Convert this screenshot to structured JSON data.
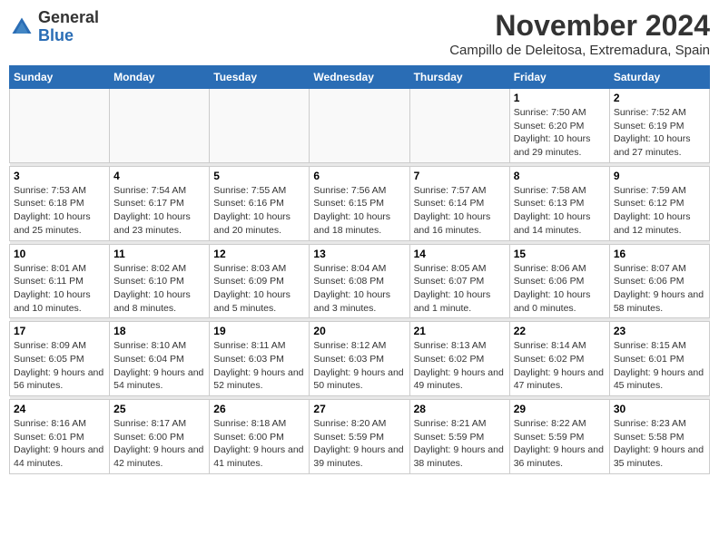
{
  "header": {
    "logo_general": "General",
    "logo_blue": "Blue",
    "month_title": "November 2024",
    "subtitle": "Campillo de Deleitosa, Extremadura, Spain"
  },
  "days_of_week": [
    "Sunday",
    "Monday",
    "Tuesday",
    "Wednesday",
    "Thursday",
    "Friday",
    "Saturday"
  ],
  "weeks": [
    [
      {
        "day": "",
        "info": ""
      },
      {
        "day": "",
        "info": ""
      },
      {
        "day": "",
        "info": ""
      },
      {
        "day": "",
        "info": ""
      },
      {
        "day": "",
        "info": ""
      },
      {
        "day": "1",
        "info": "Sunrise: 7:50 AM\nSunset: 6:20 PM\nDaylight: 10 hours and 29 minutes."
      },
      {
        "day": "2",
        "info": "Sunrise: 7:52 AM\nSunset: 6:19 PM\nDaylight: 10 hours and 27 minutes."
      }
    ],
    [
      {
        "day": "3",
        "info": "Sunrise: 7:53 AM\nSunset: 6:18 PM\nDaylight: 10 hours and 25 minutes."
      },
      {
        "day": "4",
        "info": "Sunrise: 7:54 AM\nSunset: 6:17 PM\nDaylight: 10 hours and 23 minutes."
      },
      {
        "day": "5",
        "info": "Sunrise: 7:55 AM\nSunset: 6:16 PM\nDaylight: 10 hours and 20 minutes."
      },
      {
        "day": "6",
        "info": "Sunrise: 7:56 AM\nSunset: 6:15 PM\nDaylight: 10 hours and 18 minutes."
      },
      {
        "day": "7",
        "info": "Sunrise: 7:57 AM\nSunset: 6:14 PM\nDaylight: 10 hours and 16 minutes."
      },
      {
        "day": "8",
        "info": "Sunrise: 7:58 AM\nSunset: 6:13 PM\nDaylight: 10 hours and 14 minutes."
      },
      {
        "day": "9",
        "info": "Sunrise: 7:59 AM\nSunset: 6:12 PM\nDaylight: 10 hours and 12 minutes."
      }
    ],
    [
      {
        "day": "10",
        "info": "Sunrise: 8:01 AM\nSunset: 6:11 PM\nDaylight: 10 hours and 10 minutes."
      },
      {
        "day": "11",
        "info": "Sunrise: 8:02 AM\nSunset: 6:10 PM\nDaylight: 10 hours and 8 minutes."
      },
      {
        "day": "12",
        "info": "Sunrise: 8:03 AM\nSunset: 6:09 PM\nDaylight: 10 hours and 5 minutes."
      },
      {
        "day": "13",
        "info": "Sunrise: 8:04 AM\nSunset: 6:08 PM\nDaylight: 10 hours and 3 minutes."
      },
      {
        "day": "14",
        "info": "Sunrise: 8:05 AM\nSunset: 6:07 PM\nDaylight: 10 hours and 1 minute."
      },
      {
        "day": "15",
        "info": "Sunrise: 8:06 AM\nSunset: 6:06 PM\nDaylight: 10 hours and 0 minutes."
      },
      {
        "day": "16",
        "info": "Sunrise: 8:07 AM\nSunset: 6:06 PM\nDaylight: 9 hours and 58 minutes."
      }
    ],
    [
      {
        "day": "17",
        "info": "Sunrise: 8:09 AM\nSunset: 6:05 PM\nDaylight: 9 hours and 56 minutes."
      },
      {
        "day": "18",
        "info": "Sunrise: 8:10 AM\nSunset: 6:04 PM\nDaylight: 9 hours and 54 minutes."
      },
      {
        "day": "19",
        "info": "Sunrise: 8:11 AM\nSunset: 6:03 PM\nDaylight: 9 hours and 52 minutes."
      },
      {
        "day": "20",
        "info": "Sunrise: 8:12 AM\nSunset: 6:03 PM\nDaylight: 9 hours and 50 minutes."
      },
      {
        "day": "21",
        "info": "Sunrise: 8:13 AM\nSunset: 6:02 PM\nDaylight: 9 hours and 49 minutes."
      },
      {
        "day": "22",
        "info": "Sunrise: 8:14 AM\nSunset: 6:02 PM\nDaylight: 9 hours and 47 minutes."
      },
      {
        "day": "23",
        "info": "Sunrise: 8:15 AM\nSunset: 6:01 PM\nDaylight: 9 hours and 45 minutes."
      }
    ],
    [
      {
        "day": "24",
        "info": "Sunrise: 8:16 AM\nSunset: 6:01 PM\nDaylight: 9 hours and 44 minutes."
      },
      {
        "day": "25",
        "info": "Sunrise: 8:17 AM\nSunset: 6:00 PM\nDaylight: 9 hours and 42 minutes."
      },
      {
        "day": "26",
        "info": "Sunrise: 8:18 AM\nSunset: 6:00 PM\nDaylight: 9 hours and 41 minutes."
      },
      {
        "day": "27",
        "info": "Sunrise: 8:20 AM\nSunset: 5:59 PM\nDaylight: 9 hours and 39 minutes."
      },
      {
        "day": "28",
        "info": "Sunrise: 8:21 AM\nSunset: 5:59 PM\nDaylight: 9 hours and 38 minutes."
      },
      {
        "day": "29",
        "info": "Sunrise: 8:22 AM\nSunset: 5:59 PM\nDaylight: 9 hours and 36 minutes."
      },
      {
        "day": "30",
        "info": "Sunrise: 8:23 AM\nSunset: 5:58 PM\nDaylight: 9 hours and 35 minutes."
      }
    ]
  ]
}
